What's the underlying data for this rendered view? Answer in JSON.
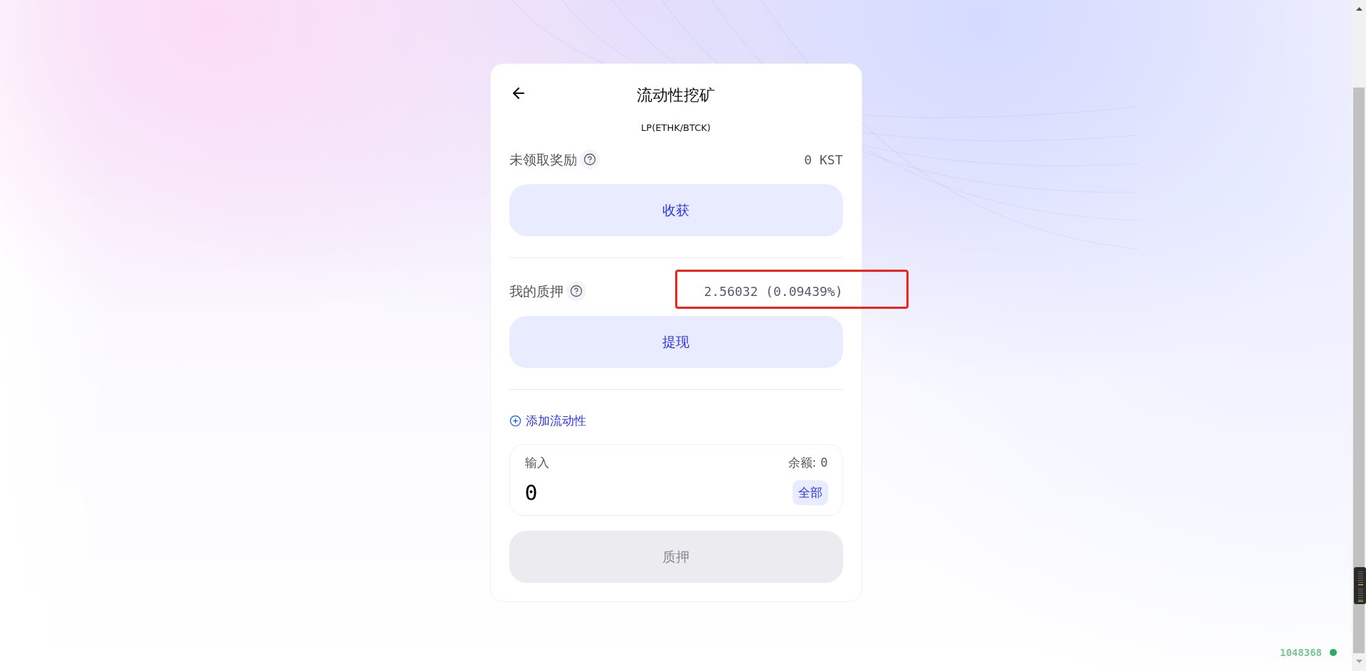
{
  "header": {
    "title": "流动性挖矿",
    "subtitle": "LP(ETHK/BTCK)"
  },
  "rewards": {
    "label": "未领取奖励",
    "value": "0 KST",
    "button": "收获"
  },
  "stake": {
    "label": "我的质押",
    "value": "2.56032 (0.09439%)",
    "highlighted": true,
    "button": "提现"
  },
  "add_liquidity": {
    "label": "添加流动性"
  },
  "input": {
    "label": "输入",
    "balance_label": "余额:",
    "balance_value": "0",
    "value": "0",
    "max_button": "全部"
  },
  "submit": {
    "label": "质押",
    "disabled": true
  },
  "corner_label": {
    "text": "1048368"
  }
}
